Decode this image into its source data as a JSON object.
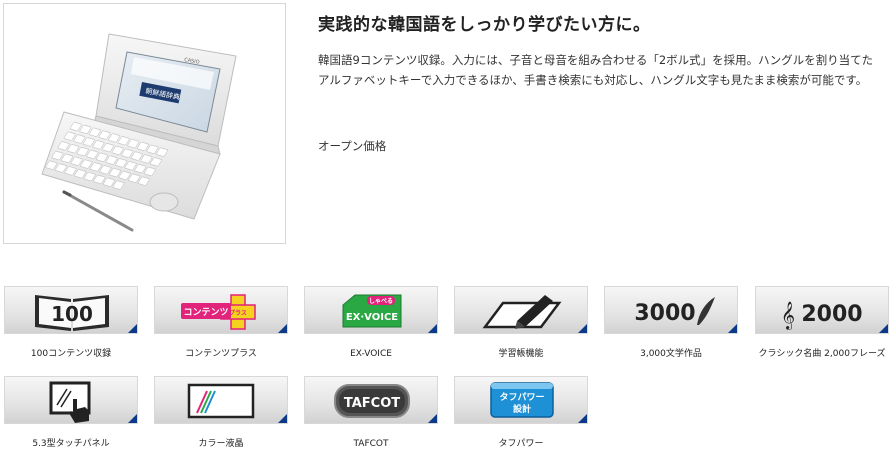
{
  "product": {
    "headline": "実践的な韓国語をしっかり学びたい方に。",
    "description": "韓国語9コンテンツ収録。入力には、子音と母音を組み合わせる「2ボル式」を採用。ハングルを割り当てたアルファベットキーで入力できるほか、手書き検索にも対応し、ハングル文字も見たまま検索が可能です。",
    "price": "オープン価格",
    "device_brand": "CASIO",
    "screen_title": "朝鮮語辞典"
  },
  "features": [
    {
      "label": "100コンテンツ収録",
      "icon": "book-100-icon",
      "icon_text": "100"
    },
    {
      "label": "コンテンツプラス",
      "icon": "contents-plus-icon",
      "icon_text": "コンテンツ",
      "icon_badge": "プラス"
    },
    {
      "label": "EX-VOICE",
      "icon": "ex-voice-icon",
      "icon_text": "EX·VOICE",
      "icon_badge": "しゃべる"
    },
    {
      "label": "学習帳機能",
      "icon": "study-notebook-icon"
    },
    {
      "label": "3,000文学作品",
      "icon": "literature-3000-icon",
      "icon_text": "3000"
    },
    {
      "label": "クラシック名曲 2,000フレーズ",
      "icon": "classic-music-2000-icon",
      "icon_text": "2000"
    },
    {
      "label": "5.3型タッチパネル",
      "icon": "touch-panel-icon"
    },
    {
      "label": "カラー液晶",
      "icon": "color-lcd-icon"
    },
    {
      "label": "TAFCOT",
      "icon": "tafcot-icon",
      "icon_text": "TAFCOT"
    },
    {
      "label": "タフパワー",
      "icon": "tough-power-icon",
      "icon_text": "タフパワー",
      "icon_subtext": "設計"
    }
  ],
  "colors": {
    "tile_corner": "#0b3a8a",
    "contents_plus_yellow": "#f4d21f",
    "contents_plus_pink": "#e2237c",
    "ex_voice_green": "#2aa844",
    "tough_power_blue": "#1e90d6"
  }
}
